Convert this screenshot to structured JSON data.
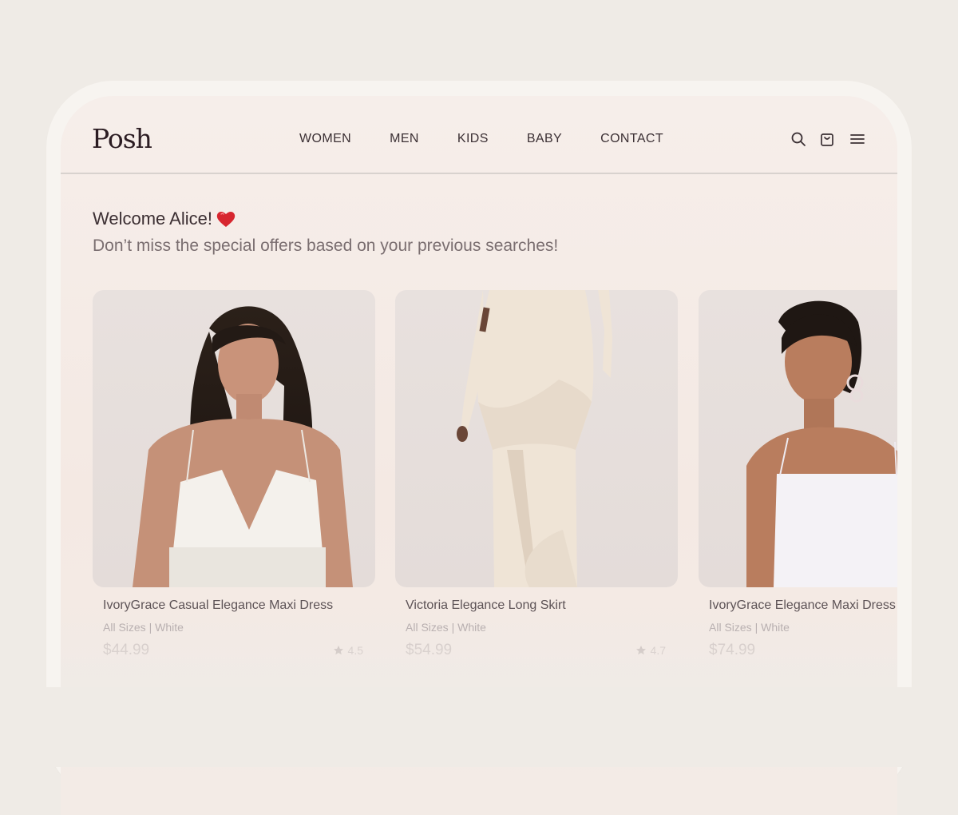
{
  "brand": {
    "logo": "Posh"
  },
  "nav": {
    "items": [
      "WOMEN",
      "MEN",
      "KIDS",
      "BABY",
      "CONTACT"
    ]
  },
  "header_icons": [
    "search-icon",
    "cart-icon",
    "menu-icon"
  ],
  "welcome": {
    "title": "Welcome Alice!",
    "subtitle": "Don’t miss the special offers based on your previous searches!"
  },
  "products": [
    {
      "name": "IvoryGrace Casual Elegance Maxi Dress",
      "meta": "All Sizes | White",
      "price": "$44.99",
      "rating": "4.5"
    },
    {
      "name": "Victoria Elegance Long Skirt",
      "meta": "All Sizes | White",
      "price": "$54.99",
      "rating": "4.7"
    },
    {
      "name": "IvoryGrace Elegance Maxi Dress",
      "meta": "All Sizes | White",
      "price": "$74.99",
      "rating": ""
    }
  ],
  "colors": {
    "background": "#efebe6",
    "text_dark": "#3b3034",
    "heart": "#d7262f",
    "muted_price": "#c8bcbb"
  }
}
